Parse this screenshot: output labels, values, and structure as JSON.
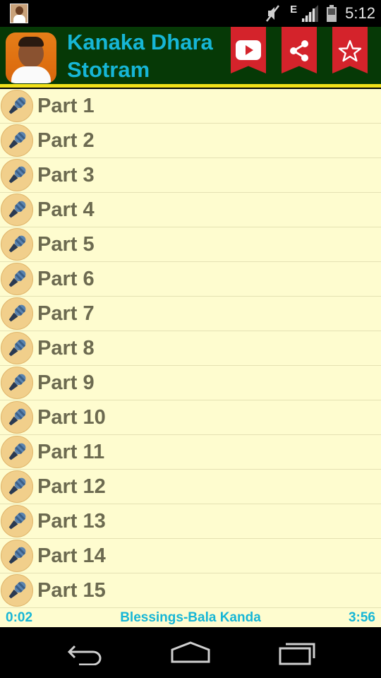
{
  "status_bar": {
    "network_type": "E",
    "time": "5:12",
    "icons": [
      "app-notification-icon",
      "mute-icon",
      "signal-icon",
      "battery-icon"
    ]
  },
  "header": {
    "title": "Kanaka Dhara Stotram",
    "avatar": "speaker-portrait",
    "buttons": [
      "youtube-icon",
      "share-icon",
      "star-icon"
    ],
    "colors": {
      "background": "#063906",
      "accent_line": "#f2e01a",
      "title": "#16b6d6",
      "button": "#d4232b"
    }
  },
  "list": {
    "item_icon": "microphone-icon",
    "items": [
      "Part 1",
      "Part 2",
      "Part 3",
      "Part 4",
      "Part 5",
      "Part 6",
      "Part 7",
      "Part 8",
      "Part 9",
      "Part 10",
      "Part 11",
      "Part 12",
      "Part 13",
      "Part 14",
      "Part 15"
    ],
    "colors": {
      "background": "#fefccf",
      "text": "#6c6a50"
    }
  },
  "player": {
    "current_time": "0:02",
    "track_title": "Blessings-Bala Kanda",
    "duration": "3:56"
  },
  "nav_bar": {
    "buttons": [
      "back-icon",
      "home-icon",
      "recent-apps-icon"
    ]
  }
}
